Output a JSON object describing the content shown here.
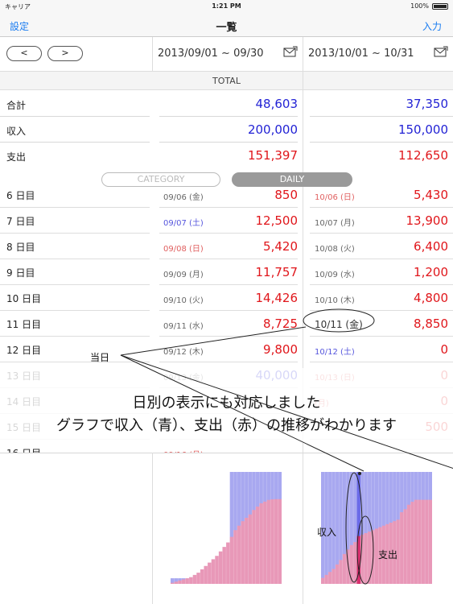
{
  "status_bar": {
    "carrier": "キャリア",
    "time": "1:21 PM",
    "battery": "100%"
  },
  "nav": {
    "left": "設定",
    "title": "一覧",
    "right": "入力"
  },
  "pager": {
    "prev": "<",
    "next": ">"
  },
  "periods": [
    "2013/09/01 ~ 09/30",
    "2013/10/01 ~ 10/31"
  ],
  "total_label": "TOTAL",
  "summary": [
    {
      "label": "合計",
      "values": [
        "48,603",
        "37,350"
      ],
      "color": "blue"
    },
    {
      "label": "収入",
      "values": [
        "200,000",
        "150,000"
      ],
      "color": "blue"
    },
    {
      "label": "支出",
      "values": [
        "151,397",
        "112,650"
      ],
      "color": "red"
    }
  ],
  "segment": {
    "category": "CATEGORY",
    "daily": "DAILY"
  },
  "daily_rows": [
    {
      "label": "6 日目",
      "d1": "09/06 (金)",
      "v1": "850",
      "d2": "10/06 (日)",
      "v2": "5,430",
      "t1": "",
      "t2": "sun"
    },
    {
      "label": "7 日目",
      "d1": "09/07 (土)",
      "v1": "12,500",
      "d2": "10/07 (月)",
      "v2": "13,900",
      "t1": "sat",
      "t2": ""
    },
    {
      "label": "8 日目",
      "d1": "09/08 (日)",
      "v1": "5,420",
      "d2": "10/08 (火)",
      "v2": "6,400",
      "t1": "sun",
      "t2": ""
    },
    {
      "label": "9 日目",
      "d1": "09/09 (月)",
      "v1": "11,757",
      "d2": "10/09 (水)",
      "v2": "1,200",
      "t1": "",
      "t2": ""
    },
    {
      "label": "10 日目",
      "d1": "09/10 (火)",
      "v1": "14,426",
      "d2": "10/10 (木)",
      "v2": "4,800",
      "t1": "",
      "t2": ""
    },
    {
      "label": "11 日目",
      "d1": "09/11 (水)",
      "v1": "8,725",
      "d2": "10/11 (金)",
      "v2": "8,850",
      "t1": "",
      "t2": "today"
    },
    {
      "label": "12 日目",
      "d1": "09/12 (木)",
      "v1": "9,800",
      "d2": "10/12 (土)",
      "v2": "0",
      "t1": "",
      "t2": "sat"
    },
    {
      "label": "13 日目",
      "d1": "09/13 (金)",
      "v1": "40,000",
      "d2": "10/13 (日)",
      "v2": "0",
      "t1": "",
      "t2": "sun",
      "c1": "blue"
    },
    {
      "label": "14 日目",
      "d1": "",
      "v1": "",
      "d2": "(月)",
      "v2": "0",
      "t1": "",
      "t2": "sun"
    },
    {
      "label": "15 日目",
      "d1": "",
      "v1": "",
      "d2": "",
      "v2": "500",
      "t1": "",
      "t2": ""
    },
    {
      "label": "16 日目",
      "d1": "09/16 (月)",
      "v1": "",
      "d2": "",
      "v2": "",
      "t1": "sun",
      "t2": ""
    }
  ],
  "annotations": {
    "today": "当日",
    "caption1": "日別の表示にも対応しました",
    "caption2": "グラフで収入（青）、支出（赤）の推移がわかります",
    "income": "収入",
    "expense": "支出"
  },
  "chart_data": [
    {
      "type": "area",
      "x": [
        1,
        2,
        3,
        4,
        5,
        6,
        7,
        8,
        9,
        10,
        11,
        12,
        13,
        14,
        15,
        16,
        17,
        18,
        19,
        20,
        21,
        22,
        23,
        24,
        25,
        26,
        27,
        28,
        29,
        30
      ],
      "series": [
        {
          "values": [
            10000,
            10000,
            10000,
            10000,
            10000,
            10000,
            10000,
            10000,
            10000,
            10000,
            10000,
            10000,
            10000,
            10000,
            10000,
            10000,
            200000,
            200000,
            200000,
            200000,
            200000,
            200000,
            200000,
            200000,
            200000,
            200000,
            200000,
            200000,
            200000,
            200000
          ]
        },
        {
          "values": [
            2000,
            4000,
            6000,
            8000,
            10000,
            12000,
            16000,
            20000,
            26000,
            32000,
            38000,
            44000,
            50000,
            58000,
            66000,
            74000,
            84000,
            96000,
            104000,
            112000,
            118000,
            124000,
            132000,
            138000,
            144000,
            147000,
            150000,
            151000,
            151397,
            151397
          ]
        }
      ],
      "colors": [
        "#a8a8f0",
        "#e898b8"
      ],
      "ylim": [
        0,
        200000
      ]
    },
    {
      "type": "area",
      "x": [
        1,
        2,
        3,
        4,
        5,
        6,
        7,
        8,
        9,
        10,
        11,
        12,
        13,
        14,
        15,
        16,
        17,
        18,
        19,
        20,
        21,
        22,
        23,
        24,
        25,
        26,
        27,
        28,
        29,
        30,
        31
      ],
      "series": [
        {
          "values": [
            150000,
            150000,
            150000,
            150000,
            150000,
            150000,
            150000,
            150000,
            150000,
            150000,
            150000,
            150000,
            150000,
            150000,
            150000,
            150000,
            150000,
            150000,
            150000,
            150000,
            150000,
            150000,
            150000,
            150000,
            150000,
            150000,
            150000,
            150000,
            150000,
            150000,
            150000
          ]
        },
        {
          "values": [
            8000,
            12000,
            16000,
            20000,
            26000,
            32000,
            40000,
            46000,
            52000,
            56000,
            64000,
            66000,
            68000,
            70000,
            72000,
            74000,
            76000,
            78000,
            80000,
            82000,
            84000,
            86000,
            96000,
            100000,
            106000,
            110000,
            112650,
            112650,
            112650,
            112650,
            112650
          ]
        }
      ],
      "colors": [
        "#a8a8f0",
        "#e898b8"
      ],
      "ylim": [
        0,
        150000
      ]
    }
  ]
}
